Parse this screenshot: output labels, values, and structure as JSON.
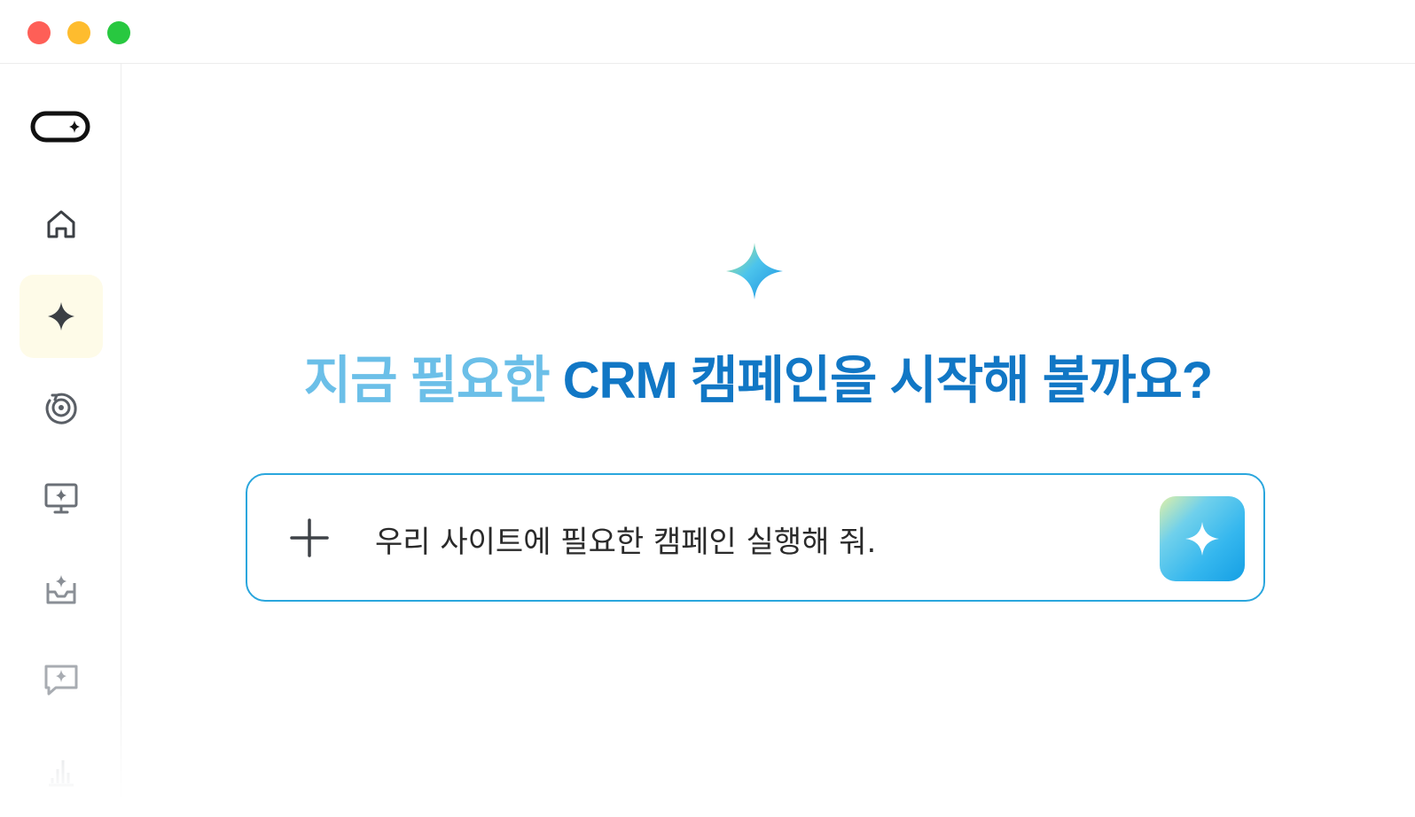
{
  "window": {
    "traffic_lights": [
      "close",
      "minimize",
      "maximize"
    ],
    "colors": {
      "close": "#fe5f57",
      "minimize": "#febc2e",
      "maximize": "#28c840"
    }
  },
  "sidebar": {
    "logo_icon": "capsule-sparkle-logo",
    "items": [
      {
        "icon": "home-icon",
        "active": false
      },
      {
        "icon": "sparkle-icon",
        "active": true
      },
      {
        "icon": "target-history-icon",
        "active": false
      },
      {
        "icon": "monitor-sparkle-icon",
        "active": false
      },
      {
        "icon": "inbox-sparkle-icon",
        "active": false
      },
      {
        "icon": "chat-sparkle-icon",
        "active": false
      },
      {
        "icon": "bar-chart-icon",
        "active": false
      }
    ],
    "active_bg": "#fefbe8"
  },
  "main": {
    "hero_icon": "gradient-sparkle-icon",
    "headline_light": "지금 필요한",
    "headline_dark": "CRM 캠페인을 시작해 볼까요?",
    "colors": {
      "light": "#6bbfe8",
      "dark": "#1177c5",
      "border": "#2aa6dd"
    },
    "prompt": {
      "add_icon": "plus-icon",
      "value": "우리 사이트에 필요한 캠페인 실행해 줘.",
      "send_icon": "sparkle-icon"
    }
  }
}
